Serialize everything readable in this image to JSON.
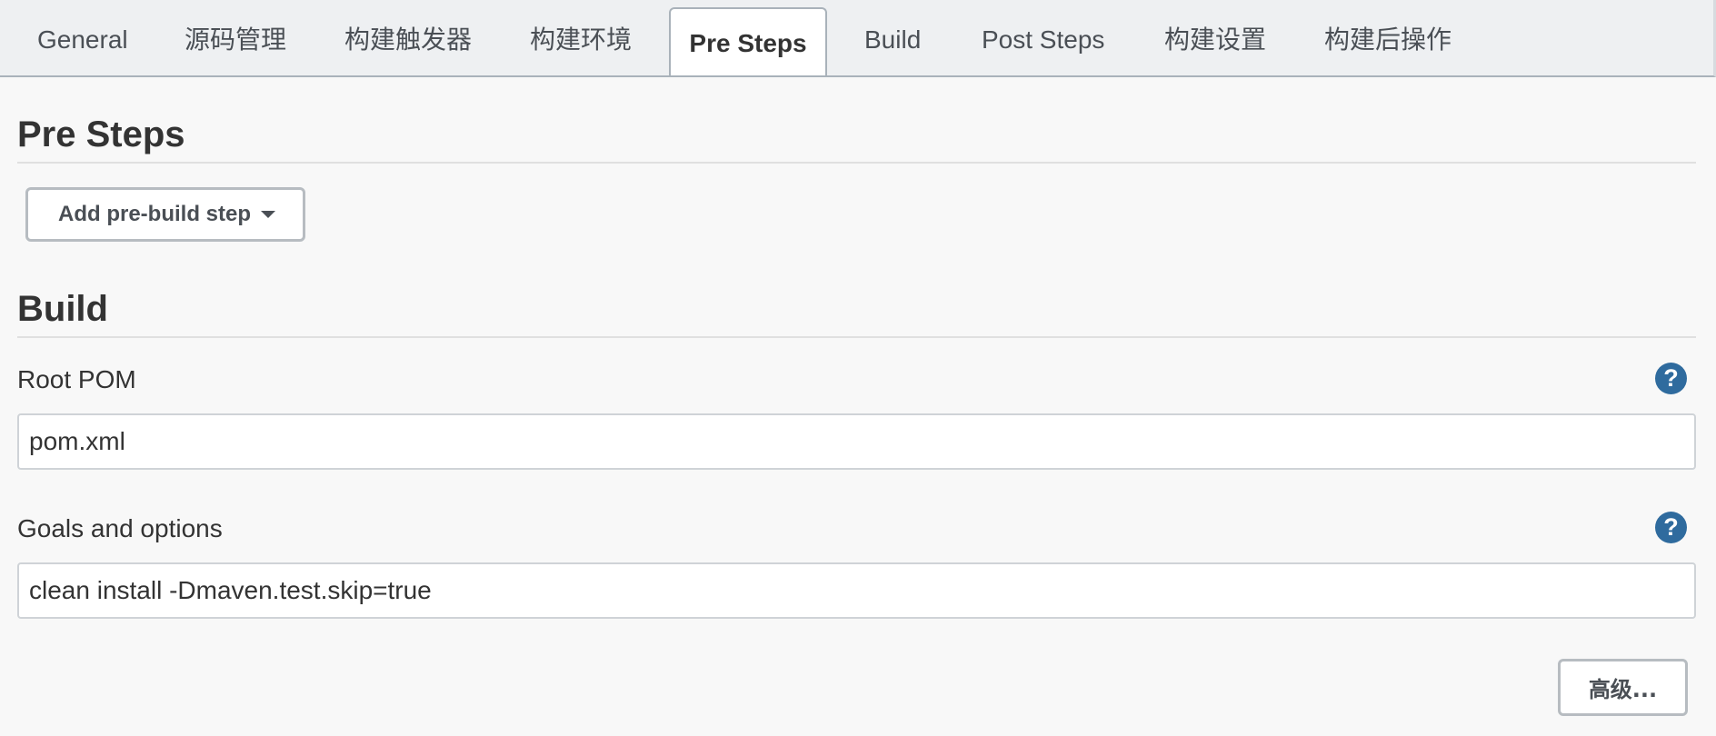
{
  "tabs": [
    {
      "label": "General",
      "active": false
    },
    {
      "label": "源码管理",
      "active": false
    },
    {
      "label": "构建触发器",
      "active": false
    },
    {
      "label": "构建环境",
      "active": false
    },
    {
      "label": "Pre Steps",
      "active": true
    },
    {
      "label": "Build",
      "active": false
    },
    {
      "label": "Post Steps",
      "active": false
    },
    {
      "label": "构建设置",
      "active": false
    },
    {
      "label": "构建后操作",
      "active": false
    }
  ],
  "pre_steps": {
    "title": "Pre Steps",
    "add_button_label": "Add pre-build step",
    "add_button_icon": "chevron-down-icon"
  },
  "build": {
    "title": "Build",
    "root_pom": {
      "label": "Root POM",
      "value": "pom.xml",
      "help_icon": "?"
    },
    "goals": {
      "label": "Goals and options",
      "value": "clean install -Dmaven.test.skip=true",
      "help_icon": "?"
    },
    "advanced_button_label": "高级..."
  },
  "colors": {
    "help_icon_bg": "#2f6b9e",
    "tab_bar_bg": "#eef0f2",
    "page_bg": "#f8f8f8"
  }
}
